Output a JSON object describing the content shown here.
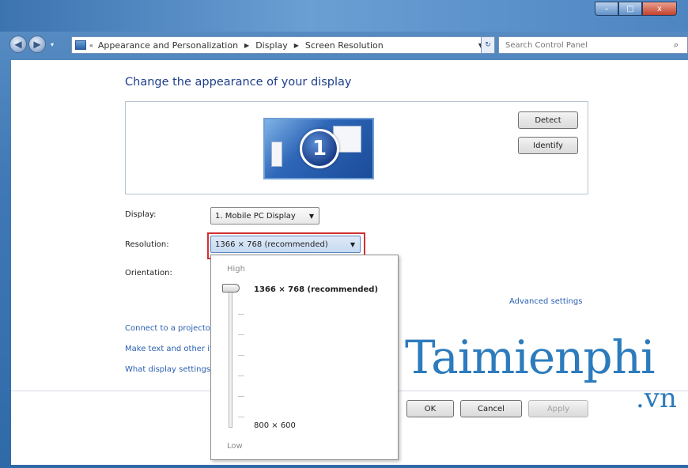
{
  "window": {
    "minimize_label": "–",
    "maximize_label": "□",
    "close_label": "x"
  },
  "address": {
    "breadcrumbs": [
      "Appearance and Personalization",
      "Display",
      "Screen Resolution"
    ],
    "search_placeholder": "Search Control Panel"
  },
  "main": {
    "title": "Change the appearance of your display",
    "monitor_number": "1",
    "detect_label": "Detect",
    "identify_label": "Identify",
    "display_label": "Display:",
    "display_value": "1. Mobile PC Display",
    "resolution_label": "Resolution:",
    "resolution_value": "1366 × 768 (recommended)",
    "orientation_label": "Orientation:",
    "advanced_link": "Advanced settings",
    "links": [
      "Connect to a projector",
      "Make text and other items larger or smaller",
      "What display settings should I choose?"
    ],
    "ok_label": "OK",
    "cancel_label": "Cancel",
    "apply_label": "Apply"
  },
  "resolution_popup": {
    "high_label": "High",
    "low_label": "Low",
    "top_resolution": "1366 × 768 (recommended)",
    "bottom_resolution": "800 × 600",
    "slider_position": 1.0
  },
  "watermark": {
    "text": "Taimienphi",
    "suffix": ".vn"
  }
}
